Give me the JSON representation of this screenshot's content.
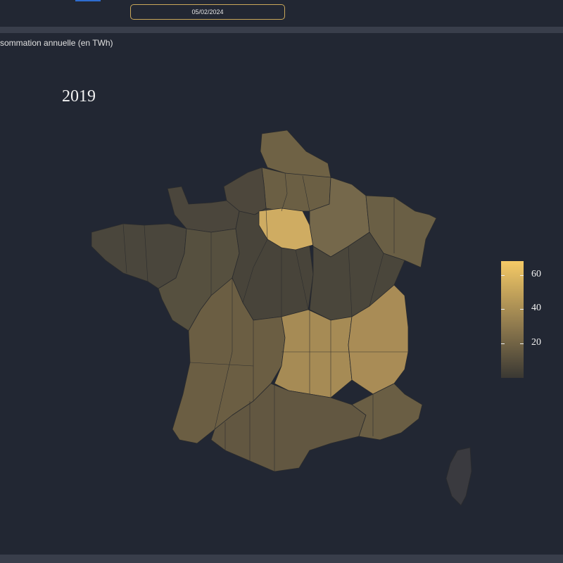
{
  "header": {
    "date_value": "05/02/2024"
  },
  "panel": {
    "title": "sommation annuelle (en TWh)"
  },
  "map": {
    "year": "2019",
    "colorscale": {
      "low": "#3a3833",
      "high": "#f5ca66"
    },
    "colorbar": {
      "ticks": [
        {
          "label": "60",
          "value": 60
        },
        {
          "label": "40",
          "value": 40
        },
        {
          "label": "20",
          "value": 20
        }
      ],
      "range": [
        0,
        68
      ]
    }
  }
}
